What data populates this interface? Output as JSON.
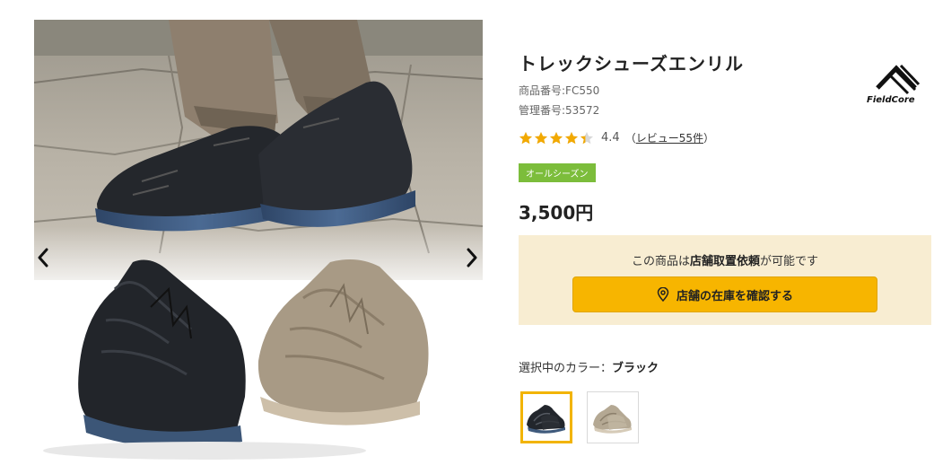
{
  "product": {
    "title": "トレックシューズエンリル",
    "product_code": "商品番号:FC550",
    "admin_code": "管理番号:53572",
    "brand": "FieldCore",
    "rating": {
      "value": 4.4,
      "value_text": "4.4",
      "review_prefix": "（",
      "review_link": "レビュー55件",
      "review_suffix": "）",
      "max_stars": 5
    },
    "season_badge": "オールシーズン",
    "price": "3,500円"
  },
  "pickup": {
    "text_before": "この商品は",
    "text_bold": "店舗取置依頼",
    "text_after": "が可能です",
    "button_label": "店舗の在庫を確認する",
    "button_icon": "map-pin-icon"
  },
  "colors": {
    "label_prefix": "選択中のカラー：",
    "selected": "ブラック",
    "options": [
      "ブラック",
      "ベージュ"
    ]
  },
  "gallery": {
    "prev_icon": "chevron-left-icon",
    "next_icon": "chevron-right-icon"
  },
  "theme": {
    "accent": "#f7b500",
    "badge_green": "#7cbd3b",
    "pickup_bg": "#f8edd2",
    "star": "#f2a900"
  }
}
